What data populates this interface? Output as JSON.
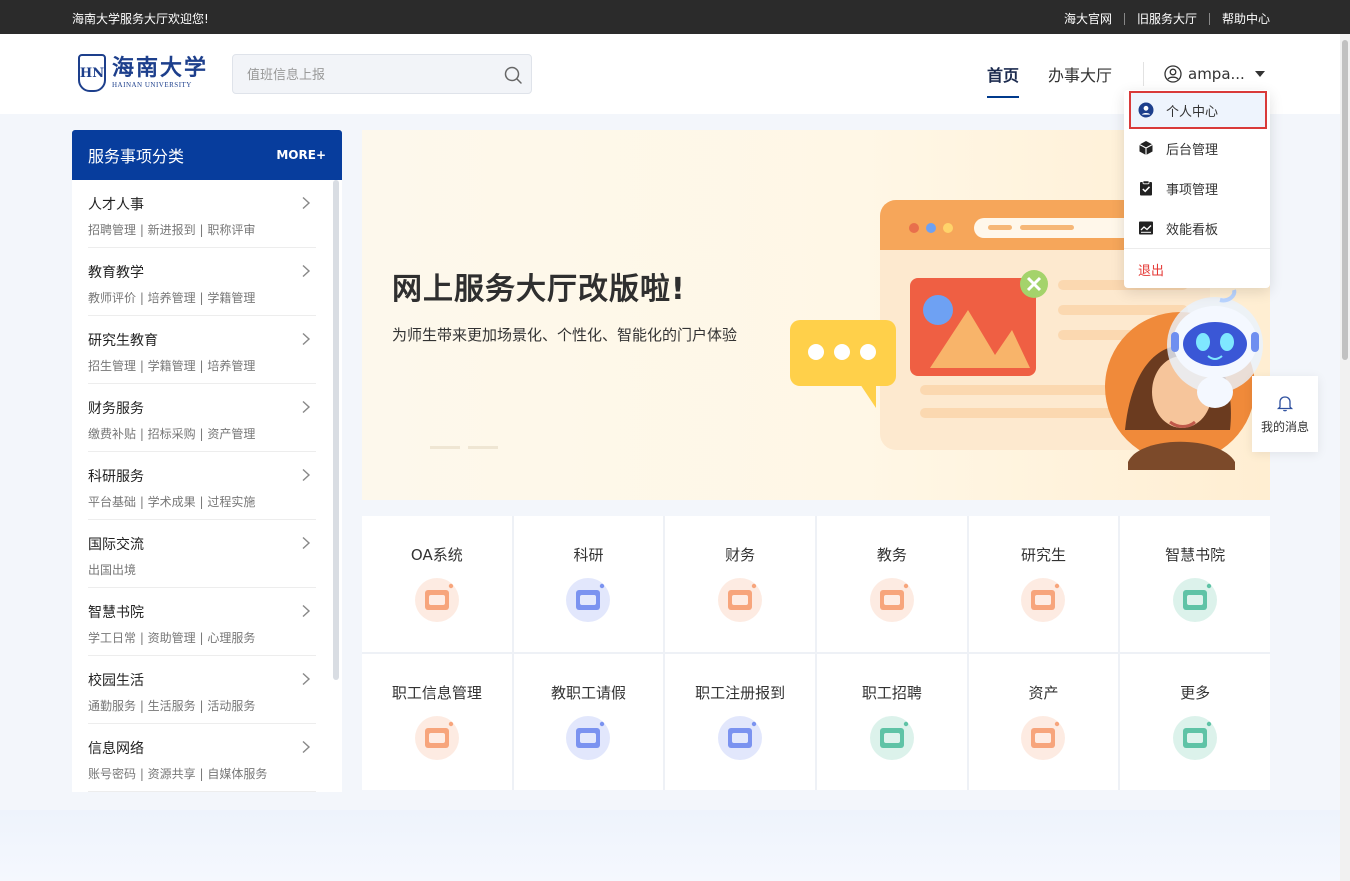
{
  "topbar": {
    "welcome": "海南大学服务大厅欢迎您!",
    "links": [
      "海大官网",
      "旧服务大厅",
      "帮助中心"
    ]
  },
  "header": {
    "logo_cn": "海南大学",
    "logo_en": "HAINAN UNIVERSITY",
    "logo_badge": "HN",
    "search_placeholder": "值班信息上报",
    "nav": {
      "home": "首页",
      "hall": "办事大厅"
    },
    "user_name": "ampa..."
  },
  "dropdown": {
    "items": [
      "个人中心",
      "后台管理",
      "事项管理",
      "效能看板"
    ],
    "logout": "退出"
  },
  "sidebar": {
    "title": "服务事项分类",
    "more": "MORE+",
    "categories": [
      {
        "title": "人才人事",
        "subs": "招聘管理 | 新进报到 | 职称评审"
      },
      {
        "title": "教育教学",
        "subs": "教师评价 | 培养管理 | 学籍管理"
      },
      {
        "title": "研究生教育",
        "subs": "招生管理 | 学籍管理 | 培养管理"
      },
      {
        "title": "财务服务",
        "subs": "缴费补贴 | 招标采购 | 资产管理"
      },
      {
        "title": "科研服务",
        "subs": "平台基础 | 学术成果 | 过程实施"
      },
      {
        "title": "国际交流",
        "subs": "出国出境"
      },
      {
        "title": "智慧书院",
        "subs": "学工日常 | 资助管理 | 心理服务"
      },
      {
        "title": "校园生活",
        "subs": "通勤服务 | 生活服务 | 活动服务"
      },
      {
        "title": "信息网络",
        "subs": "账号密码 | 资源共享 | 自媒体服务"
      }
    ]
  },
  "banner": {
    "title": "网上服务大厅改版啦!",
    "subtitle": "为师生带来更加场景化、个性化、智能化的门户体验"
  },
  "message_float": {
    "label": "我的消息"
  },
  "services": [
    {
      "label": "OA系统",
      "icon": "oa-icon",
      "color": "#f7a57c"
    },
    {
      "label": "科研",
      "icon": "research-icon",
      "color": "#7b93f0"
    },
    {
      "label": "财务",
      "icon": "finance-icon",
      "color": "#f7a57c"
    },
    {
      "label": "教务",
      "icon": "academic-icon",
      "color": "#f7a57c"
    },
    {
      "label": "研究生",
      "icon": "graduate-icon",
      "color": "#f7a57c"
    },
    {
      "label": "智慧书院",
      "icon": "academy-icon",
      "color": "#5fc3a6"
    },
    {
      "label": "职工信息管理",
      "icon": "staff-info-icon",
      "color": "#f7a57c"
    },
    {
      "label": "教职工请假",
      "icon": "leave-icon",
      "color": "#7b93f0"
    },
    {
      "label": "职工注册报到",
      "icon": "register-icon",
      "color": "#7b93f0"
    },
    {
      "label": "职工招聘",
      "icon": "recruit-icon",
      "color": "#5fc3a6"
    },
    {
      "label": "资产",
      "icon": "asset-icon",
      "color": "#f7a57c"
    },
    {
      "label": "更多",
      "icon": "more-icon",
      "color": "#5fc3a6"
    }
  ],
  "colors": {
    "brand": "#073d9d",
    "topbar": "#2b2b2b",
    "highlight_border": "#d93a3a"
  }
}
